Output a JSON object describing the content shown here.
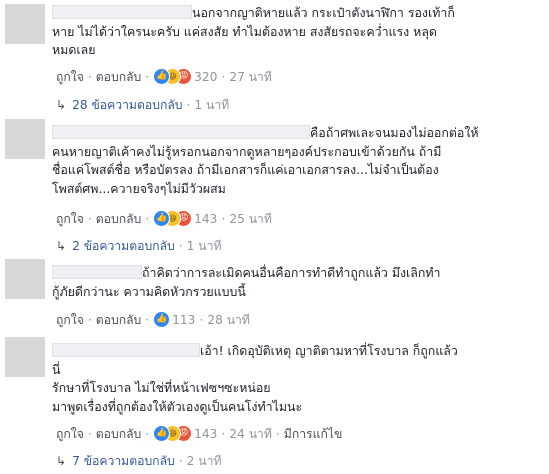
{
  "labels": {
    "like": "ถูกใจ",
    "reply": "ตอบกลับ",
    "edited": "มีการแก้ไข"
  },
  "comments": [
    {
      "lines": [
        "นอกจากญาติหายแล้ว กระเป๋าตังนาฬิกา รองเท้าก็",
        "หาย ไม่ได้ว่าใครนะครับ แค่สงสัย ทำไมต้องหาย สงสัยรถจะคว่ำแรง หลุด",
        "หมดเลย"
      ],
      "reaction_count": "320",
      "time": "27 นาที",
      "replies_label": "28 ข้อความตอบกลับ",
      "replies_time": "1 นาที"
    },
    {
      "lines": [
        "คือถ้าศพเละจนมองไม่ออกต่อให้",
        "คนหายญาติเค้าคงไม่รู้หรอกนอกจากดูหลายๆองค์ประกอบเข้าด้วยกัน ถ้ามี",
        "ชื่อแค่โพสต์ชื่อ หรือบัตรลง ถ้ามีเอกสารก็แค่เอาเอกสารลง...ไม่จำเป็นต้อง",
        "โพสต์ศพ...ควายจริงๆไม่มีวัวผสม"
      ],
      "reaction_count": "143",
      "time": "25 นาที",
      "replies_label": "2 ข้อความตอบกลับ",
      "replies_time": "1 นาที"
    },
    {
      "lines": [
        "ถ้าคิดว่าการละเมิดคนอื่นคือการทำดีทำถูกแล้ว มึงเลิกทำ",
        "กู้ภัยดีกว่านะ ความคิดหัวกรวยแบบนี้"
      ],
      "reaction_count": "113",
      "time": "28 นาที"
    },
    {
      "lines": [
        "เอ้า! เกิดอุบัติเหตุ ญาติตามหาที่โรงบาล ก็ถูกแล้ว",
        "นี่",
        "รักษาที่โรงบาล ไม่ใช่ที่หน้าเฟซฯซะหน่อย",
        "มาพูดเรื่องที่ถูกต้องให้ตัวเองดูเป็นคนโง่ทำไมนะ"
      ],
      "reaction_count": "143",
      "time": "24 นาที",
      "replies_label": "7 ข้อความตอบกลับ",
      "replies_time": "2 นาที"
    }
  ]
}
